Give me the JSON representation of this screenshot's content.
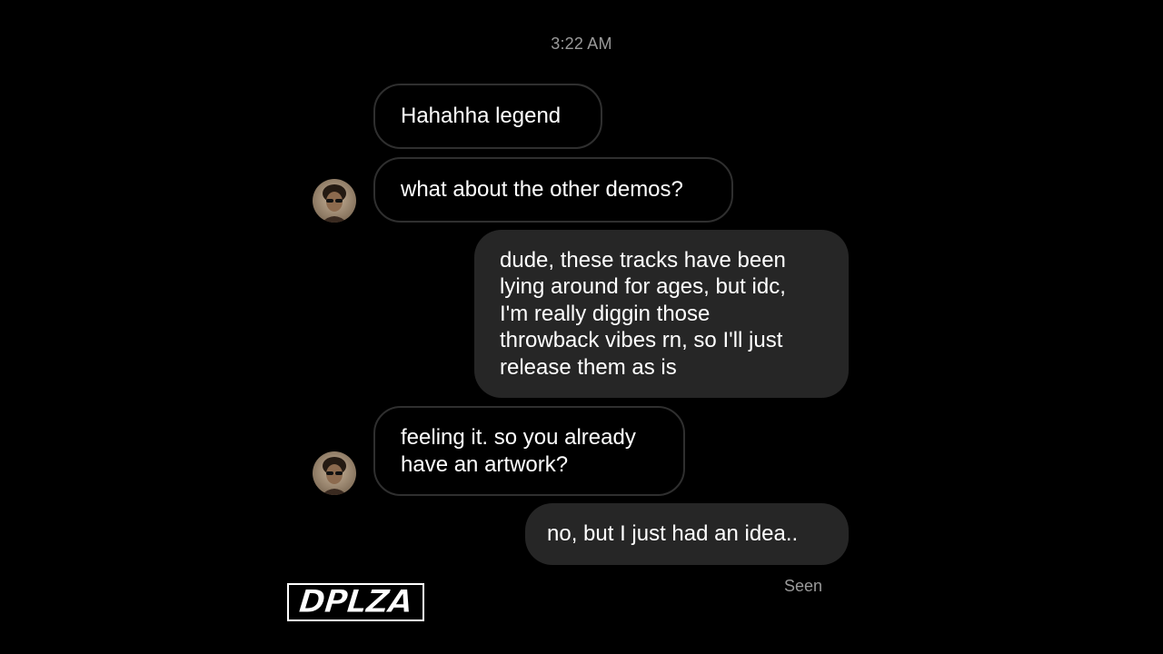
{
  "timestamp": "3:22 AM",
  "messages": [
    {
      "direction": "incoming",
      "text": "Hahahha legend"
    },
    {
      "direction": "incoming",
      "text": "what about the other demos?"
    },
    {
      "direction": "outgoing",
      "text": "dude, these tracks have been\nlying around for ages, but idc,\nI'm really diggin those\nthrowback vibes rn, so I'll just\nrelease them as is"
    },
    {
      "direction": "incoming",
      "text": "feeling it. so you already\nhave an artwork?"
    },
    {
      "direction": "outgoing",
      "text": "no, but I just had an idea.."
    }
  ],
  "status": {
    "seen_label": "Seen"
  },
  "brand": {
    "logo_text": "DPLZA"
  },
  "colors": {
    "background": "#000000",
    "outgoing_bubble": "#262626",
    "incoming_border": "#2f2f2f",
    "meta_text": "#9a9a9a"
  },
  "icons": {
    "avatar": "user-avatar-photo"
  }
}
